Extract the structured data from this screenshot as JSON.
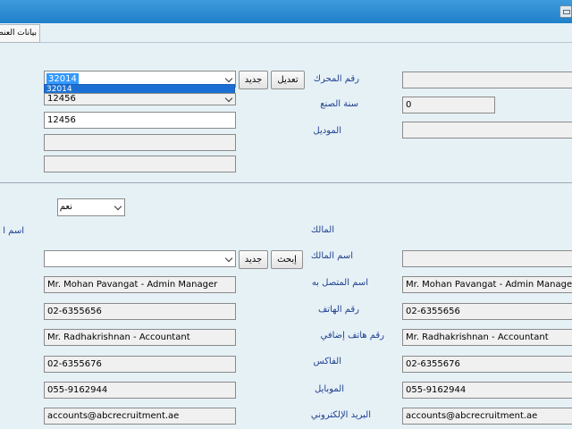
{
  "tab": {
    "label": "بيانات العنصر"
  },
  "vehicle": {
    "dropdown_value": "32014",
    "dropdown_option": "32014",
    "second_select_value": "12456",
    "field_value": "12456",
    "edit_button": "تعديل",
    "new_button": "جديد",
    "engine_label": "رقم المحرك",
    "year_label": "سنة الصنع",
    "year_value": "0",
    "model_label": "الموديل"
  },
  "owner": {
    "yes_no_value": "نعم",
    "owner_label": "المالك",
    "owner_name_label_left": "اسم ا",
    "owner_name_label": "اسم المالك",
    "search_button": "إبحث",
    "new_button": "جديد",
    "contact_label": "اسم المتصل به",
    "contact_value": "Mr. Mohan Pavangat - Admin Manager",
    "phone_label": "رقم الهاتف",
    "phone_value": "02-6355656",
    "extra_phone_label": "رقم هاتف إضافي",
    "extra_phone_value": "Mr. Radhakrishnan - Accountant",
    "fax_label": "الفاكس",
    "fax_value": "02-6355676",
    "mobile_label": "الموبايل",
    "mobile_value": "055-9162944",
    "email_label": "البريد الإلكتروني",
    "email_value": "accounts@abcrecruitment.ae"
  }
}
